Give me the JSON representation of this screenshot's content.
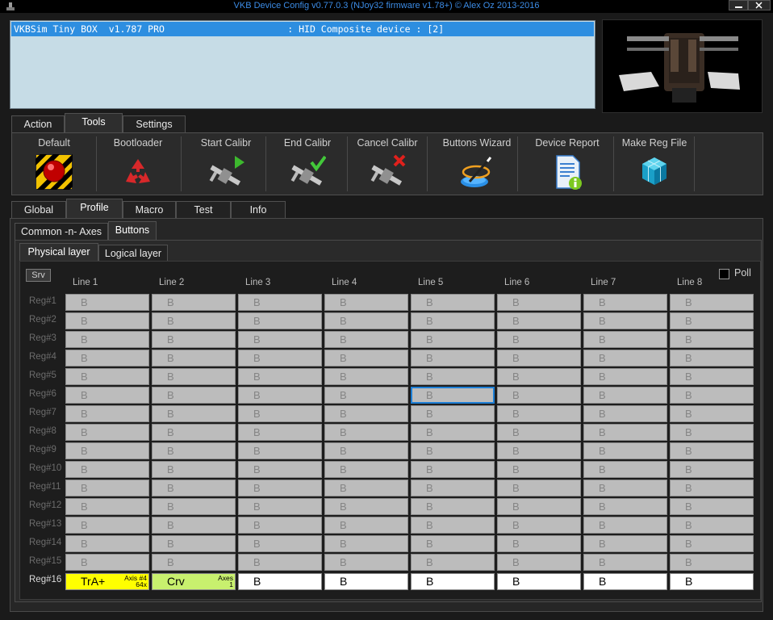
{
  "window": {
    "title": "VKB Device Config v0.77.0.3 (NJoy32 firmware v1.78+) © Alex Oz 2013-2016"
  },
  "device_list": {
    "rows": [
      "VKBSim Tiny BOX  v1.787 PRO                      : HID Composite device : [2]"
    ]
  },
  "main_tabs": [
    "Action",
    "Tools",
    "Settings"
  ],
  "tools": [
    "Default",
    "Bootloader",
    "Start Calibr",
    "End Calibr",
    "Cancel Calibr",
    "Buttons Wizard",
    "Device Report",
    "Make Reg File"
  ],
  "config_tabs": [
    "Global",
    "Profile",
    "Macro",
    "Test",
    "Info"
  ],
  "profile_tabs": [
    "Common -n- Axes",
    "Buttons"
  ],
  "layer_tabs": [
    "Physical layer",
    "Logical layer"
  ],
  "grid": {
    "srv_label": "Srv",
    "poll_label": "Poll",
    "columns": [
      "Line 1",
      "Line 2",
      "Line 3",
      "Line 4",
      "Line 5",
      "Line 6",
      "Line 7",
      "Line 8"
    ],
    "rows": [
      "Reg#1",
      "Reg#2",
      "Reg#3",
      "Reg#4",
      "Reg#5",
      "Reg#6",
      "Reg#7",
      "Reg#8",
      "Reg#9",
      "Reg#10",
      "Reg#11",
      "Reg#12",
      "Reg#13",
      "Reg#14",
      "Reg#15",
      "Reg#16"
    ],
    "cell_value": "B",
    "last_row": [
      {
        "text": "TrA+",
        "sub1": "Axis #4",
        "sub2": "64x"
      },
      {
        "text": "Crv",
        "sub1": "Axes",
        "sub2": "1"
      },
      {
        "text": "B"
      },
      {
        "text": "B"
      },
      {
        "text": "B"
      },
      {
        "text": "B"
      },
      {
        "text": "B"
      },
      {
        "text": "B"
      }
    ]
  },
  "colors": {
    "selection": "#2d8ee0",
    "title": "#3c8ce6",
    "yellow_cell": "#ffff00",
    "green_cell": "#c8f06e"
  }
}
